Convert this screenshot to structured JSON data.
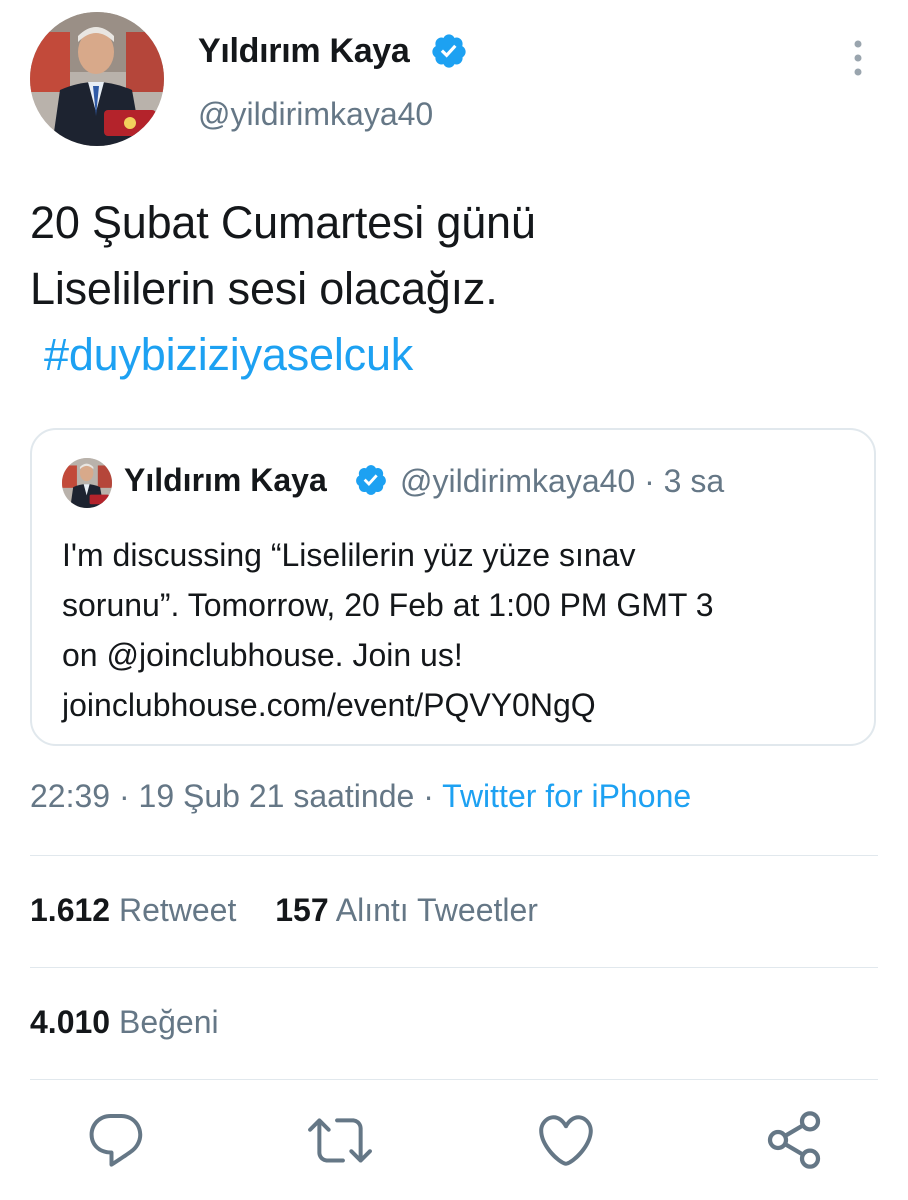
{
  "author": {
    "display_name": "Yıldırım Kaya",
    "handle": "@yildirimkaya40",
    "verified": true
  },
  "tweet": {
    "text_line1": "20 Şubat Cumartesi günü",
    "text_line2": "Liselilerin sesi olacağız.",
    "hashtag": "#duybiziziyaselcuk"
  },
  "quoted_tweet": {
    "display_name": "Yıldırım Kaya",
    "handle": "@yildirimkaya40",
    "separator": "·",
    "age": "3 sa",
    "body_line1": "I'm discussing “Liselilerin yüz yüze sınav",
    "body_line2": "sorunu”. Tomorrow, 20 Feb at 1:00 PM GMT 3",
    "body_line3": "on @joinclubhouse. Join us!",
    "body_line4": "joinclubhouse.com/event/PQVY0NgQ"
  },
  "meta": {
    "time": "22:39",
    "date": "19 Şub 21 saatinde",
    "separator": "·",
    "source": "Twitter for iPhone"
  },
  "stats": {
    "retweets_count": "1.612",
    "retweets_label": "Retweet",
    "quotes_count": "157",
    "quotes_label": "Alıntı Tweetler",
    "likes_count": "4.010",
    "likes_label": "Beğeni"
  },
  "colors": {
    "accent": "#1da1f2",
    "text": "#14171a",
    "secondary": "#657786",
    "border": "#e1e8ed"
  },
  "icons": {
    "reply": "comment-icon",
    "retweet": "retweet-icon",
    "like": "heart-icon",
    "share": "share-icon",
    "more": "more-vertical-icon",
    "verified": "verified-badge-icon"
  }
}
